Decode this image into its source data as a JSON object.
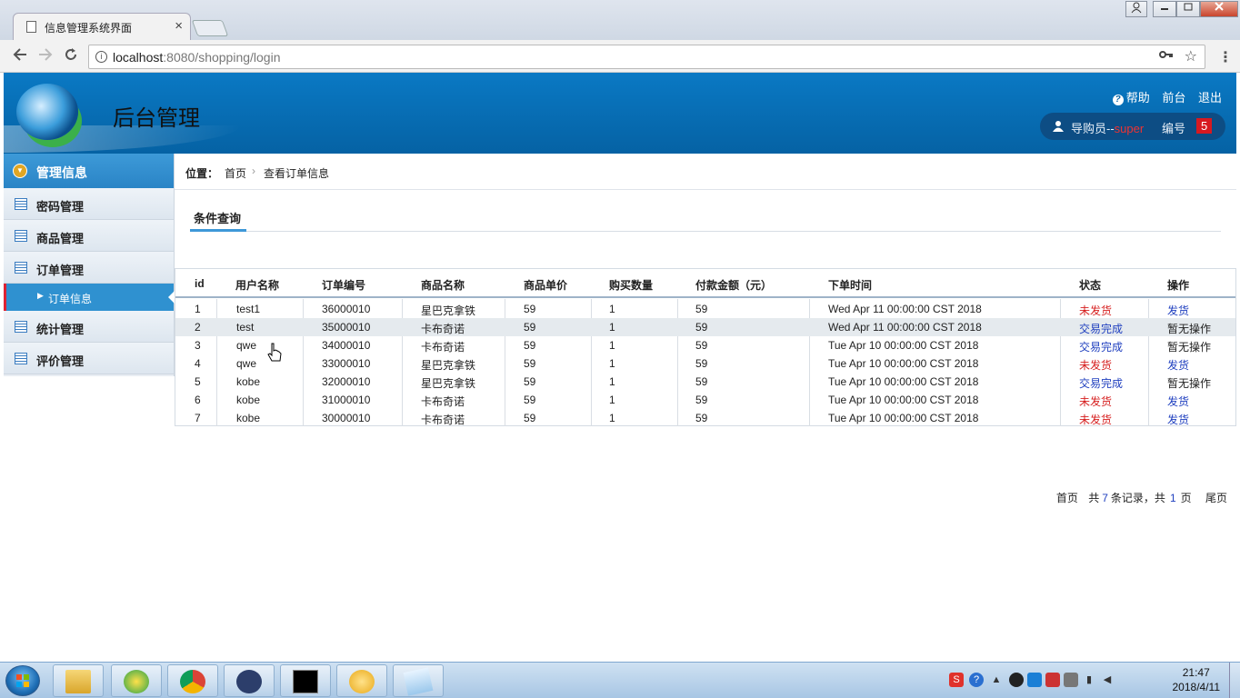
{
  "browser": {
    "tab_title": "信息管理系统界面",
    "close": "×",
    "url_host": "localhost",
    "url_rest": ":8080/shopping/login",
    "menu": "⋮"
  },
  "header": {
    "app_title": "后台管理",
    "links": [
      "帮助",
      "前台",
      "退出"
    ],
    "user_prefix": "导购员--",
    "user_name": "super",
    "id_label": "编号",
    "id_value": "5"
  },
  "sidebar": {
    "head": "管理信息",
    "items": [
      "密码管理",
      "商品管理",
      "订单管理",
      "统计管理",
      "评价管理"
    ],
    "sub_item": "订单信息"
  },
  "breadcrumb": {
    "position_label": "位置：",
    "home": "首页",
    "separator": "›",
    "current": "查看订单信息"
  },
  "query_tab": "条件查询",
  "table": {
    "columns": [
      "id",
      "用户名称",
      "订单编号",
      "商品名称",
      "商品单价",
      "购买数量",
      "付款金额（元）",
      "下单时间",
      "状态",
      "操作"
    ],
    "rows": [
      [
        "1",
        "test1",
        "36000010",
        "星巴克拿铁",
        "59",
        "1",
        "59",
        "Wed Apr 11 00:00:00 CST 2018",
        "未发货",
        "发货"
      ],
      [
        "2",
        "test",
        "35000010",
        "卡布奇诺",
        "59",
        "1",
        "59",
        "Wed Apr 11 00:00:00 CST 2018",
        "交易完成",
        "暂无操作"
      ],
      [
        "3",
        "qwe",
        "34000010",
        "卡布奇诺",
        "59",
        "1",
        "59",
        "Tue Apr 10 00:00:00 CST 2018",
        "交易完成",
        "暂无操作"
      ],
      [
        "4",
        "qwe",
        "33000010",
        "星巴克拿铁",
        "59",
        "1",
        "59",
        "Tue Apr 10 00:00:00 CST 2018",
        "未发货",
        "发货"
      ],
      [
        "5",
        "kobe",
        "32000010",
        "星巴克拿铁",
        "59",
        "1",
        "59",
        "Tue Apr 10 00:00:00 CST 2018",
        "交易完成",
        "暂无操作"
      ],
      [
        "6",
        "kobe",
        "31000010",
        "卡布奇诺",
        "59",
        "1",
        "59",
        "Tue Apr 10 00:00:00 CST 2018",
        "未发货",
        "发货"
      ],
      [
        "7",
        "kobe",
        "30000010",
        "卡布奇诺",
        "59",
        "1",
        "59",
        "Tue Apr 10 00:00:00 CST 2018",
        "未发货",
        "发货"
      ]
    ]
  },
  "pager": {
    "first": "首页",
    "total_prefix": "共",
    "total_records": "7",
    "records_suffix": "条记录，共",
    "total_pages": "1",
    "pages_suffix": "页",
    "last": "尾页"
  },
  "taskbar": {
    "time": "21:47",
    "date": "2018/4/11"
  },
  "colors": {
    "header_blue": "#0562a4",
    "status_red": "#d61e1e",
    "link_blue": "#1f3fbf",
    "sidebar_active": "#2f91d0"
  }
}
